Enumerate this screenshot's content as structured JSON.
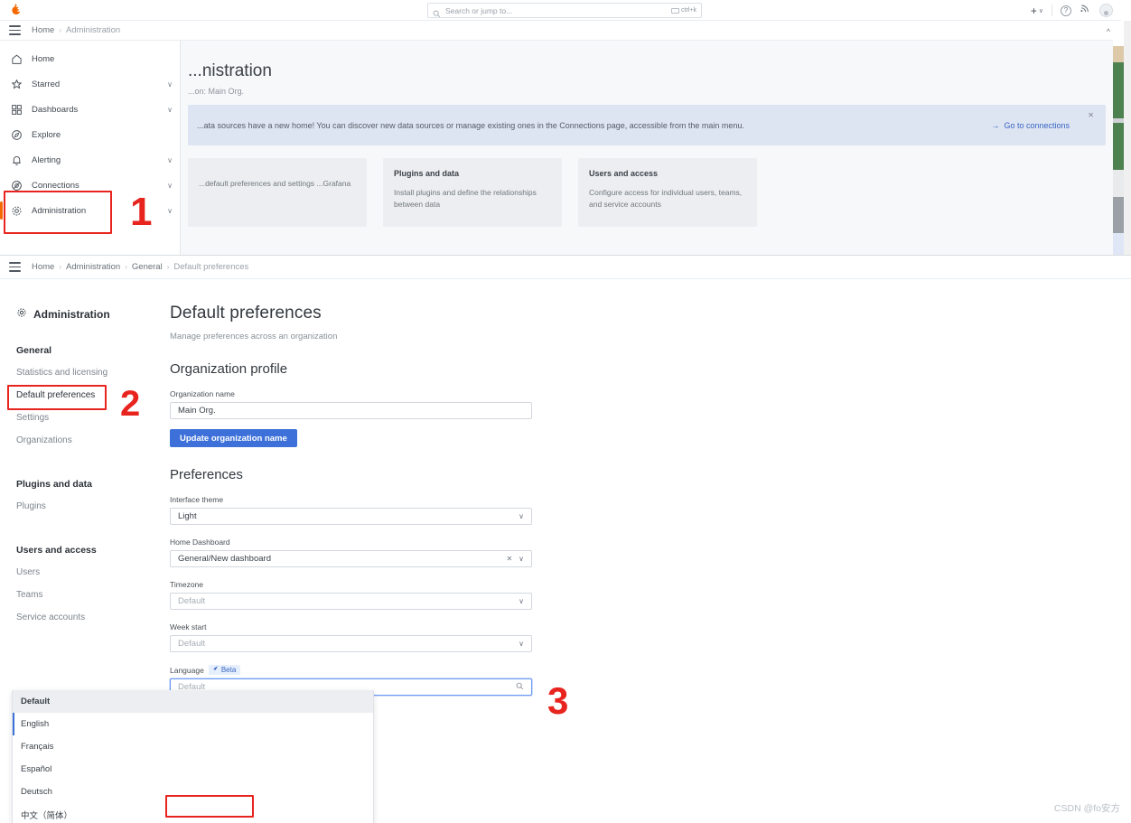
{
  "window_top": {
    "topbar": {
      "logo_icon": "grafana-logo",
      "search": {
        "placeholder": "Search or jump to...",
        "icon": "search-icon",
        "shortcut": "ctrl+k",
        "shortcut_icon": "keyboard-icon"
      },
      "actions": {
        "plus_label": "+",
        "plus_chevron": "∨",
        "help_icon": "help-circle-icon",
        "news_icon": "news-rss-icon",
        "avatar_icon": "user-avatar"
      }
    },
    "breadcrumb": {
      "items": [
        "Home",
        "Administration"
      ],
      "separator": "›",
      "collapse_icon": "chevron-up-icon"
    },
    "megamenu": {
      "items": [
        {
          "label": "Home",
          "icon": "home-icon",
          "expandable": false,
          "active": false
        },
        {
          "label": "Starred",
          "icon": "star-icon",
          "expandable": true,
          "active": false
        },
        {
          "label": "Dashboards",
          "icon": "apps-grid-icon",
          "expandable": true,
          "active": false
        },
        {
          "label": "Explore",
          "icon": "compass-icon",
          "expandable": false,
          "active": false
        },
        {
          "label": "Alerting",
          "icon": "bell-icon",
          "expandable": true,
          "active": false
        },
        {
          "label": "Connections",
          "icon": "connections-icon",
          "expandable": true,
          "active": false
        },
        {
          "label": "Administration",
          "icon": "gear-icon",
          "expandable": true,
          "active": true
        }
      ],
      "chevron": "∨"
    },
    "page": {
      "title": "...nistration",
      "subtitle": "...on: Main Org.",
      "banner": {
        "message": "...ata sources have a new home! You can discover new data sources or manage existing ones in the Connections page, accessible from the main menu.",
        "link_label": "Go to connections",
        "link_icon": "arrow-right-icon",
        "close_icon": "close-icon"
      },
      "cards": [
        {
          "title": "",
          "description": "...default preferences and settings\n...Grafana"
        },
        {
          "title": "Plugins and data",
          "description": "Install plugins and define the relationships between data"
        },
        {
          "title": "Users and access",
          "description": "Configure access for individual users, teams, and service accounts"
        }
      ]
    }
  },
  "window_bottom": {
    "breadcrumb": {
      "items": [
        "Home",
        "Administration",
        "General",
        "Default preferences"
      ],
      "separator": "›",
      "menu_icon": "hamburger-icon"
    },
    "sidebar": {
      "title": "Administration",
      "title_icon": "gear-icon",
      "sections": [
        {
          "heading": "General",
          "links": [
            "Statistics and licensing",
            "Default preferences",
            "Settings",
            "Organizations"
          ],
          "selected": "Default preferences"
        },
        {
          "heading": "Plugins and data",
          "links": [
            "Plugins"
          ],
          "selected": ""
        },
        {
          "heading": "Users and access",
          "links": [
            "Users",
            "Teams",
            "Service accounts"
          ],
          "selected": ""
        }
      ]
    },
    "main": {
      "title": "Default preferences",
      "subtitle": "Manage preferences across an organization",
      "org_profile": {
        "heading": "Organization profile",
        "name_label": "Organization name",
        "name_value": "Main Org.",
        "update_button": "Update organization name"
      },
      "preferences": {
        "heading": "Preferences",
        "fields": [
          {
            "label": "Interface theme",
            "value": "Light",
            "placeholder": "",
            "clearable": false,
            "chevron": "∨"
          },
          {
            "label": "Home Dashboard",
            "value": "General/New dashboard",
            "placeholder": "",
            "clearable": true,
            "clear_icon": "clear-x-icon",
            "chevron": "∨"
          },
          {
            "label": "Timezone",
            "value": "Default",
            "placeholder": "",
            "clearable": false,
            "chevron": "∨"
          },
          {
            "label": "Week start",
            "value": "Default",
            "placeholder": "",
            "clearable": false,
            "chevron": "∨"
          }
        ],
        "language": {
          "label": "Language",
          "badge": "Beta",
          "badge_icon": "rocket-icon",
          "placeholder": "Default",
          "value": "",
          "search_icon": "search-icon",
          "options": [
            "Default",
            "English",
            "Français",
            "Español",
            "Deutsch",
            "中文（简体）"
          ],
          "highlighted_option": "Default",
          "marked_option": "English"
        }
      }
    }
  },
  "annotations": [
    {
      "number": "1",
      "target": "megamenu-administration"
    },
    {
      "number": "2",
      "target": "sidebar-default-preferences"
    },
    {
      "number": "3",
      "target": "language-dropdown"
    }
  ],
  "watermark": "CSDN @fo安方",
  "colors": {
    "accent_blue": "#3d71d9",
    "annotation_red": "#e8241f",
    "orange": "#f46800",
    "banner_bg": "#dde4f2"
  }
}
